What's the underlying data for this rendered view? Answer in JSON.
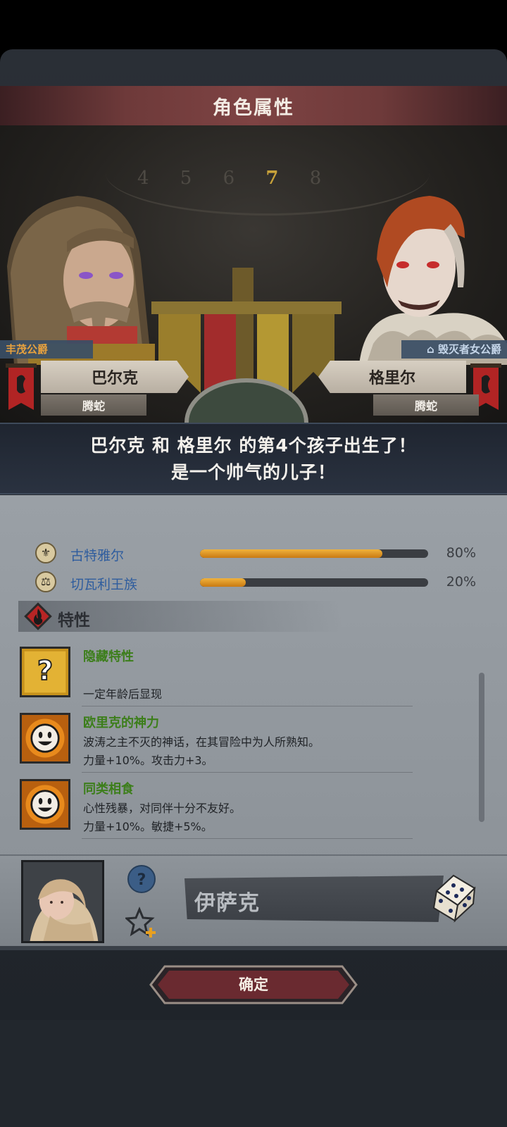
{
  "title": "角色属性",
  "parents": {
    "left": {
      "title": "丰茂公爵",
      "name": "巴尔克",
      "faction": "腾蛇"
    },
    "right": {
      "title": "毁灭者女公爵",
      "name": "格里尔",
      "faction": "腾蛇"
    }
  },
  "announcement": {
    "line1": "巴尔克 和 格里尔 的第4个孩子出生了！",
    "line2": "是一个帅气的儿子！"
  },
  "clock_numbers": {
    "before": "4 5 6 ",
    "highlight": "7",
    "after": " 8"
  },
  "factions": [
    {
      "name": "古特雅尔",
      "percent_label": "80%",
      "value": 0.8
    },
    {
      "name": "切瓦利王族",
      "percent_label": "20%",
      "value": 0.2
    }
  ],
  "traits_section": {
    "title": "特性"
  },
  "traits": [
    {
      "name": "隐藏特性",
      "lines": [
        "",
        "一定年龄后显现"
      ]
    },
    {
      "name": "欧里克的神力",
      "lines": [
        "波涛之主不灭的神话，在其冒险中为人所熟知。",
        "力量+10%。攻击力+3。"
      ]
    },
    {
      "name": "同类相食",
      "lines": [
        "心性残暴，对同伴十分不友好。",
        "力量+10%。敏捷+5%。"
      ]
    }
  ],
  "naming": {
    "child_name": "伊萨克"
  },
  "confirm_label": "确定",
  "colors": {
    "title_bar": "#7e4343",
    "faction_name": "#2f5d9e",
    "trait_name": "#3c7e1a",
    "bar_fill": "#f0b23c",
    "left_title": "#e7a13e"
  }
}
